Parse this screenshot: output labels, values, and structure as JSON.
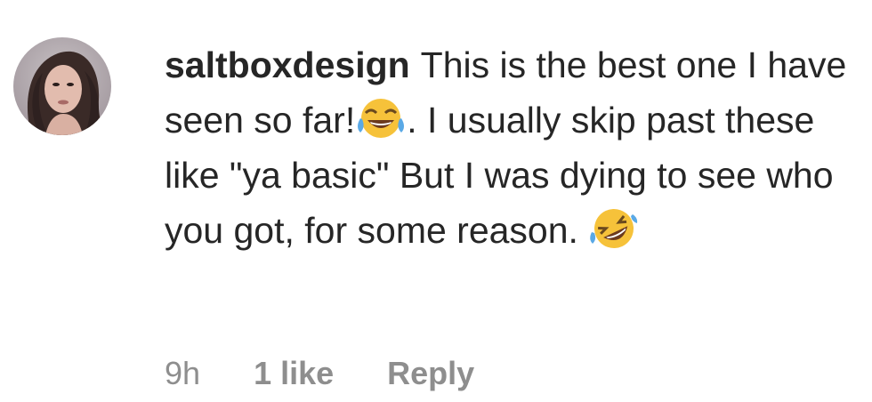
{
  "comment": {
    "username": "saltboxdesign",
    "text_part1": "This is the best one I have seen so far!",
    "emoji_1": "face-with-tears-of-joy-icon",
    "text_part2": ". I usually skip past these like \"ya basic\" But I was dying to see who you got, for some reason. ",
    "emoji_2": "rolling-on-the-floor-laughing-icon",
    "time_ago": "9h",
    "likes": "1 like",
    "reply_label": "Reply"
  },
  "colors": {
    "text": "#262626",
    "meta": "#8e8e8e",
    "emoji_yellow": "#f6c23a"
  }
}
